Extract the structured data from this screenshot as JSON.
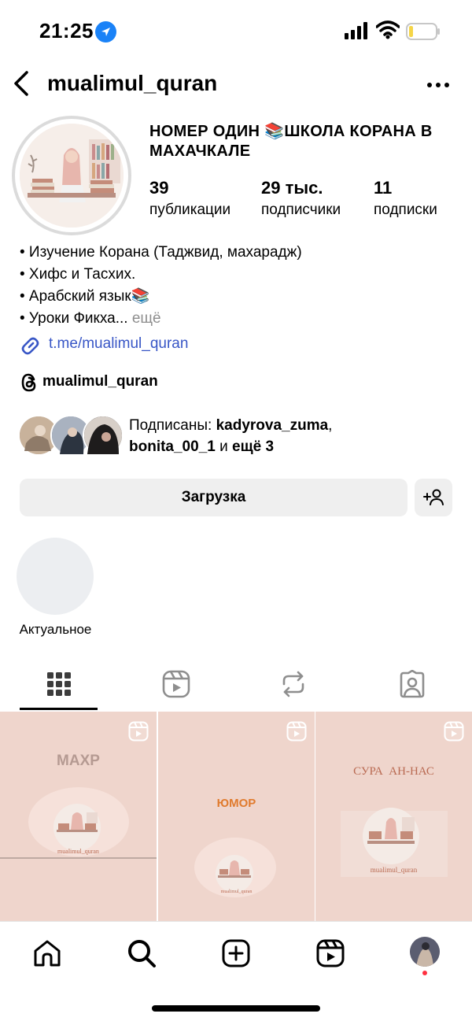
{
  "status_bar": {
    "time": "21:25",
    "location_icon": "location-arrow-icon",
    "signal_icon": "cellular-signal-icon",
    "wifi_icon": "wifi-icon",
    "battery_icon": "battery-low-icon",
    "battery_color": "#f5d547"
  },
  "header": {
    "back_icon": "chevron-left-icon",
    "username": "mualimul_quran",
    "more_icon": "ellipsis-icon"
  },
  "profile": {
    "title": "НОМЕР ОДИН 📚ШКОЛА КОРАНА В МАХАЧКАЛЕ",
    "stats": [
      {
        "value": "39",
        "label": "публикации"
      },
      {
        "value": "29 тыс.",
        "label": "подписчики"
      },
      {
        "value": "11",
        "label": "подписки"
      }
    ],
    "bio_lines": [
      "• Изучение Корана (Таджвид, махарадж)",
      "• Хифс и Тасхих.",
      "• Арабский язык📚",
      "• Уроки Фикха..."
    ],
    "bio_more": " ещё",
    "link": "t.me/mualimul_quran",
    "threads_handle": "mualimul_quran",
    "followed_by": {
      "prefix": "Подписаны: ",
      "user1": "kadyrova_zuma",
      "sep": ", ",
      "user2": "bonita_00_1",
      "mid": " и ",
      "rest": "ещё 3"
    }
  },
  "actions": {
    "primary_label": "Загрузка",
    "add_icon": "add-person-icon"
  },
  "highlights": [
    {
      "label": "Актуальное"
    }
  ],
  "tabs": [
    {
      "name": "grid-icon",
      "active": true
    },
    {
      "name": "reels-icon",
      "active": false
    },
    {
      "name": "repost-icon",
      "active": false
    },
    {
      "name": "tagged-icon",
      "active": false
    }
  ],
  "posts": [
    {
      "title": "МАХР",
      "watermark": "mualimul_quran"
    },
    {
      "title": "ЮМОР",
      "watermark": "mualimul_quran"
    },
    {
      "title": "СУРА  АН-НАС",
      "watermark": "mualimul_quran"
    }
  ],
  "bottom_nav": [
    "home-icon",
    "search-icon",
    "create-icon",
    "reels-icon",
    "profile-avatar"
  ],
  "colors": {
    "link": "#3856c6",
    "button_bg": "#efefef",
    "post_bg": "#efd5cc",
    "accent_orange": "#e07b2e",
    "notify": "#ff3040"
  }
}
